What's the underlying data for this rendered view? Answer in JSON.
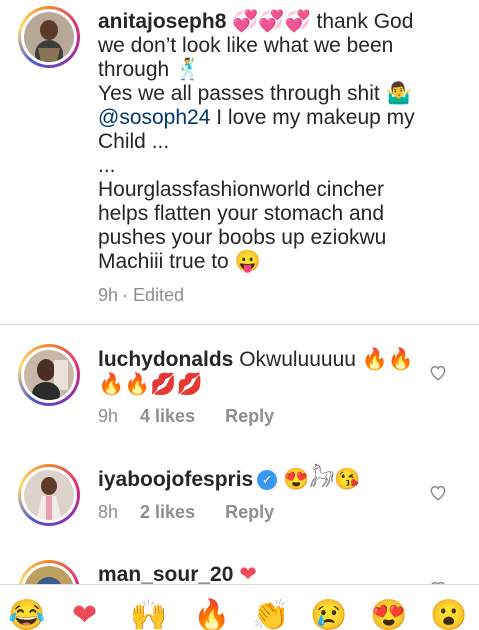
{
  "caption": {
    "username": "anitajoseph8",
    "line1_rest": " 💞💞💞 thank God",
    "line2": "we don’t look like what we been",
    "line3": "through 🕺",
    "line4": "Yes we all passes through shit 🤷‍♂",
    "mention": "@sosoph24",
    "line5_rest": " I love my makeup my",
    "line6": "Child ...",
    "line7": "...",
    "line8": "Hourglassfashionworld cincher",
    "line9": "helps flatten your stomach and",
    "line10": "pushes your boobs up eziokwu",
    "line11": "Machiii true to 😛",
    "time": "9h",
    "edited": "· Edited"
  },
  "comments": [
    {
      "username": "luchydonalds",
      "text_line1": " Okwuluuuuu 🔥🔥",
      "text_line2": "🔥🔥💋💋",
      "time": "9h",
      "likes": "4 likes",
      "reply": "Reply"
    },
    {
      "username": "iyaboojofespris",
      "verified": "✓",
      "text": " 😍𓃗😘",
      "time": "8h",
      "likes": "2 likes",
      "reply": "Reply"
    },
    {
      "username": "man_sour_20",
      "text": " ❤"
    }
  ],
  "emoji_bar": [
    "😂",
    "❤",
    "🙌",
    "🔥",
    "👏",
    "😢",
    "😍",
    "😮"
  ]
}
